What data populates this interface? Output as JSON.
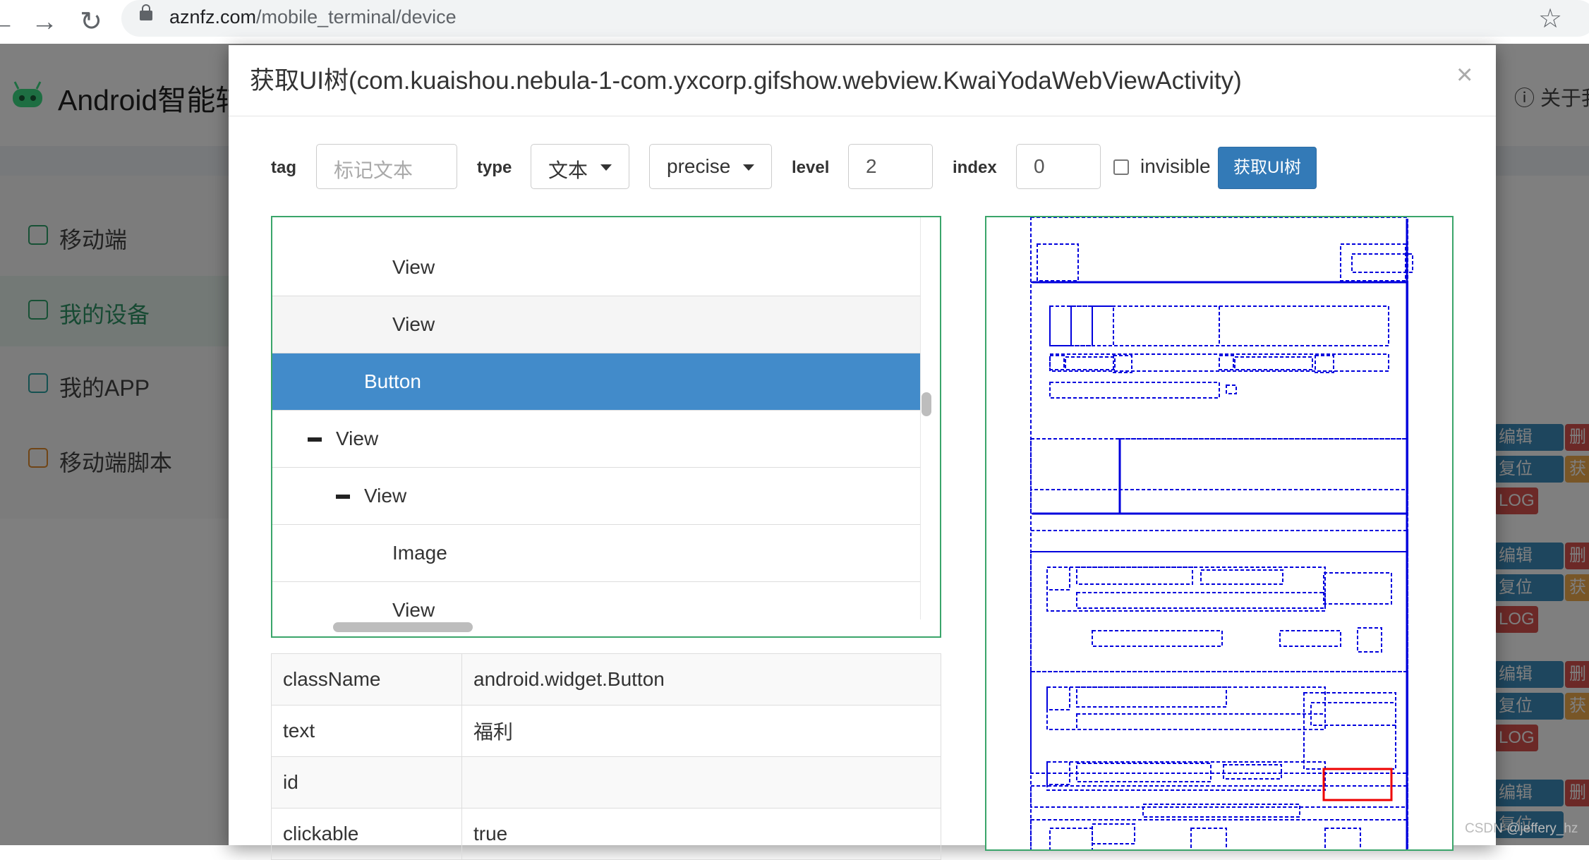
{
  "browser": {
    "back": "←",
    "forward": "→",
    "reload": "↻",
    "url_domain": "aznfz.com",
    "url_path": "/mobile_terminal/device",
    "star": "☆"
  },
  "app": {
    "title": "Android智能辅",
    "about": "ⓘ 关于我",
    "sidebar": [
      {
        "label": "移动端",
        "icon": "user-edit-icon"
      },
      {
        "label": "我的设备",
        "icon": "devices-icon",
        "active": true
      },
      {
        "label": "我的APP",
        "icon": "bag-icon"
      },
      {
        "label": "移动端脚本",
        "icon": "script-icon"
      }
    ],
    "actions": {
      "edit": "编辑",
      "delete": "删",
      "reset": "复位",
      "fetch": "获",
      "log": "LOG"
    }
  },
  "modal": {
    "title": "获取UI树(com.kuaishou.nebula-1-com.yxcorp.gifshow.webview.KwaiYodaWebViewActivity)",
    "close": "×",
    "form": {
      "tag_label": "tag",
      "tag_placeholder": "标记文本",
      "type_label": "type",
      "type_value": "文本",
      "match_value": "precise",
      "level_label": "level",
      "level_value": "2",
      "index_label": "index",
      "index_value": "0",
      "invisible_label": "invisible",
      "invisible_checked": false,
      "submit_label": "获取UI树"
    },
    "tree": [
      {
        "label": "View",
        "indent": 2
      },
      {
        "label": "View",
        "indent": 2,
        "state": "hover"
      },
      {
        "label": "Button",
        "indent": 2,
        "state": "selected"
      },
      {
        "label": "View",
        "indent": 1,
        "toggle": "collapse"
      },
      {
        "label": "View",
        "indent": 2,
        "toggle": "collapse"
      },
      {
        "label": "Image",
        "indent": 2
      },
      {
        "label": "View",
        "indent": 2
      }
    ],
    "properties": [
      {
        "key": "className",
        "value": "android.widget.Button"
      },
      {
        "key": "text",
        "value": "福利"
      },
      {
        "key": "id",
        "value": ""
      },
      {
        "key": "clickable",
        "value": "true"
      }
    ],
    "preview": {
      "node_color": "#0000dd",
      "selected_color": "#ee0000"
    }
  },
  "watermark": "CSDN @jeffery_hz"
}
